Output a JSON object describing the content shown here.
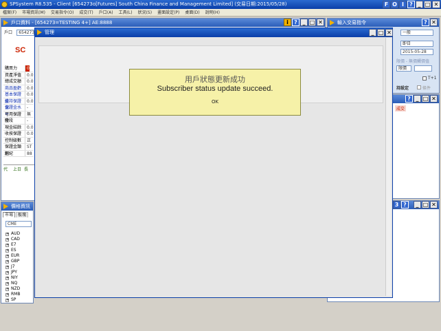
{
  "app": {
    "title": "SPSystem R8.535 - Client [654273o[Futures] South China Finance and Management Limited] (交易日期:2015/05/28)",
    "toolbar_letters": [
      "F",
      "O",
      "I",
      "?"
    ],
    "menu": [
      "檔案(F)",
      "市場資訊(M)",
      "交易指令(O)",
      "成交(T)",
      "戶口(A)",
      "工具(L)",
      "狀況(S)",
      "畫面設定(P)",
      "桌面(D)",
      "說明(H)"
    ]
  },
  "account_panel": {
    "title": "戶口資料 - [654273=TESTING 4+] AE:8888",
    "account_label": "戶口",
    "account_value": "654273",
    "logo": "SC",
    "rows": [
      {
        "label": "購買力",
        "value": "0"
      },
      {
        "label": "資產淨值",
        "value": "0.0"
      },
      {
        "label": "總成交額",
        "value": "0.0"
      },
      {
        "label": "商品盈虧",
        "value": "0.0"
      },
      {
        "label": "基本保證金",
        "value": "0.0"
      },
      {
        "label": "維持保證金",
        "value": "0.0"
      },
      {
        "label": "保證金水平",
        "value": "-"
      },
      {
        "label": "可用保證金",
        "value": "無"
      },
      {
        "label": "時段",
        "value": "-"
      },
      {
        "label": "現金結餘",
        "value": "0.0"
      },
      {
        "label": "收按保證",
        "value": "0.0"
      },
      {
        "label": "控制級數",
        "value": "正"
      },
      {
        "label": "保證金類別",
        "value": "ST"
      },
      {
        "label": "經紀",
        "value": "88"
      }
    ],
    "tabs": [
      "代",
      "上日",
      "長"
    ]
  },
  "order_panel": {
    "title": "輸入交易指令",
    "labels": [
      "市",
      "期",
      "數",
      "價",
      "觸",
      "持設定",
      "T+1",
      "條件"
    ],
    "fields": [
      "一般",
      "即日",
      "2015-05-28",
      "限價",
      ""
    ],
    "hint": "限價 - 無價觸價值",
    "hold_setting": "持設定",
    "t1_label": "T+1",
    "cond_label": "條件"
  },
  "price_panel": {
    "title": "價格資訊",
    "tabs": [
      "市場",
      "板塊"
    ],
    "exchange": "CME",
    "items": [
      "AUD",
      "CAD",
      "E7",
      "ES",
      "EUR",
      "GBP",
      "J7",
      "JPY",
      "NIY",
      "NQ",
      "NZD",
      "RMB",
      "SP"
    ]
  },
  "right_panel": {
    "tag": "成交"
  },
  "modal": {
    "title": "管理",
    "message_cn": "用戶狀態更新成功",
    "message_en": "Subscriber status update succeed.",
    "ok_label": "OK"
  },
  "colors": {
    "titlebar": "#0a3ea8",
    "message_bg": "#f6f1a8",
    "highlight_red": "#cc2200"
  }
}
